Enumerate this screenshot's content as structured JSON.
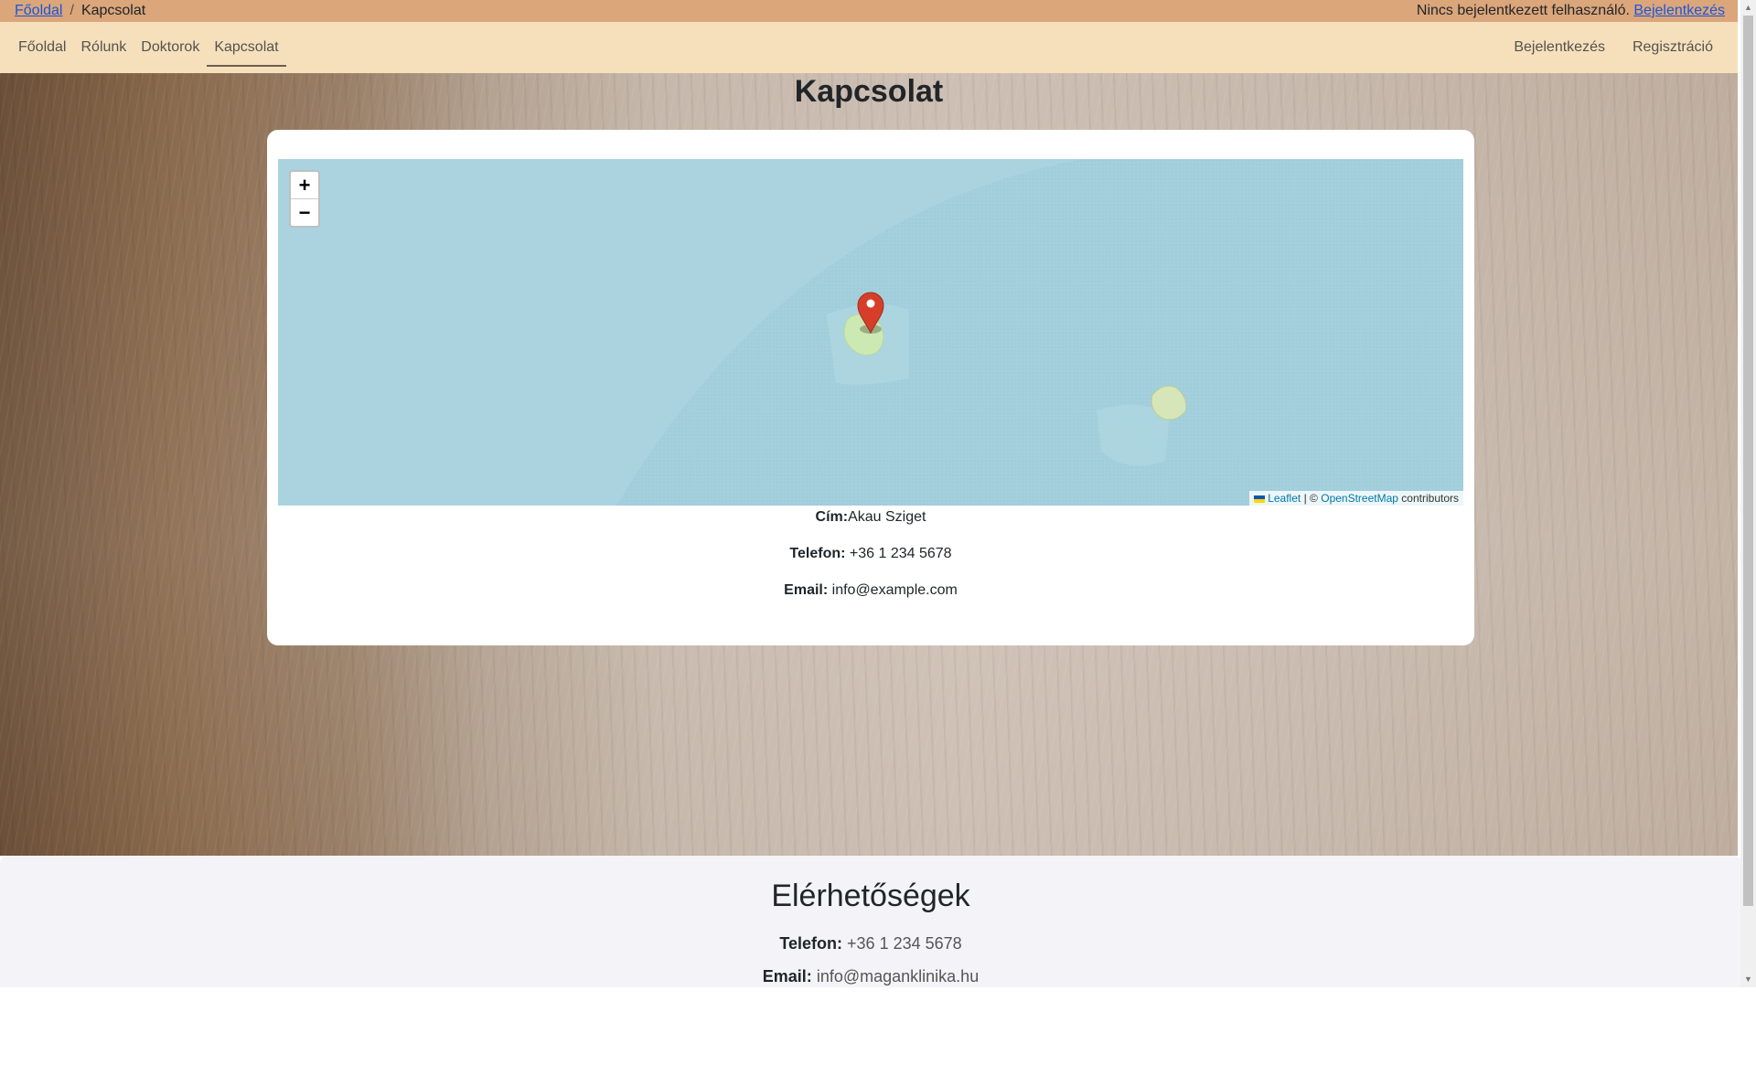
{
  "breadcrumb": {
    "home": "Főoldal",
    "separator": "/",
    "current": "Kapcsolat"
  },
  "user_status": {
    "text": "Nincs bejelentkezett felhasználó.",
    "login_link": "Bejelentkezés"
  },
  "nav": {
    "items": [
      {
        "label": "Főoldal"
      },
      {
        "label": "Rólunk"
      },
      {
        "label": "Doktorok"
      },
      {
        "label": "Kapcsolat",
        "active": true
      }
    ],
    "right": [
      {
        "label": "Bejelentkezés"
      },
      {
        "label": "Regisztráció"
      }
    ]
  },
  "page": {
    "title": "Kapcsolat"
  },
  "map": {
    "zoom_in": "+",
    "zoom_out": "−",
    "attribution": {
      "leaflet": "Leaflet",
      "separator": "|",
      "copyright": "©",
      "osm": "OpenStreetMap",
      "contributors": "contributors"
    },
    "marker_icon": "map-pin-icon"
  },
  "contact": {
    "address_label": "Cím:",
    "address": "Akau Sziget",
    "phone_label": "Telefon:",
    "phone": "+36 1 234 5678",
    "email_label": "Email:",
    "email": "info@example.com"
  },
  "footer": {
    "title": "Elérhetőségek",
    "phone_label": "Telefon:",
    "phone": "+36 1 234 5678",
    "email_label": "Email:",
    "email": "info@maganklinika.hu"
  },
  "colors": {
    "topbar": "#dba67a",
    "navbar": "#f6e0bc",
    "water": "#aad3df",
    "island": "#cde9b3",
    "marker": "#d63e2a",
    "link": "#1a56db"
  }
}
